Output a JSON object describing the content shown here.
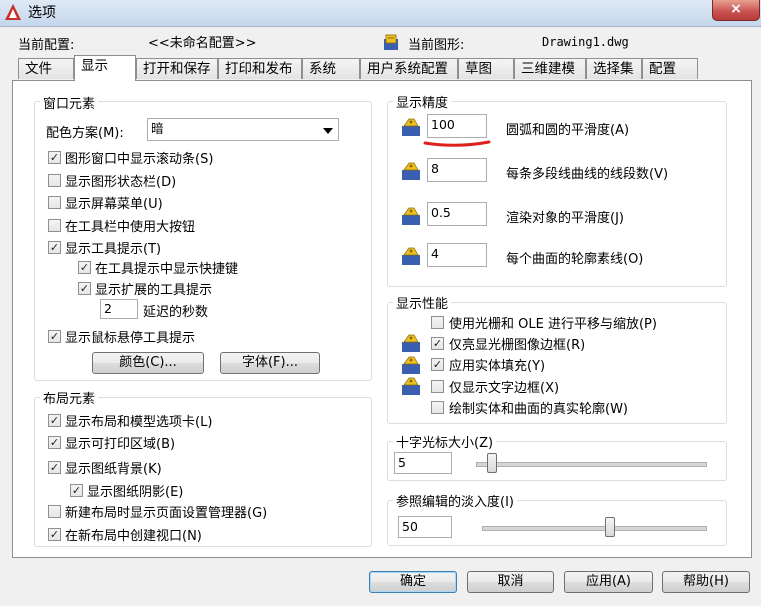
{
  "window": {
    "title": "选项",
    "close_label": "×"
  },
  "profile": {
    "current_profile_label": "当前配置:",
    "current_profile_value": "<<未命名配置>>",
    "current_drawing_label": "当前图形:",
    "current_drawing_value": "Drawing1.dwg"
  },
  "tabs": [
    "文件",
    "显示",
    "打开和保存",
    "打印和发布",
    "系统",
    "用户系统配置",
    "草图",
    "三维建模",
    "选择集",
    "配置"
  ],
  "window_elements": {
    "title": "窗口元素",
    "color_scheme_label": "配色方案(M):",
    "color_scheme_value": "暗",
    "checks": [
      {
        "label": "图形窗口中显示滚动条(S)",
        "checked": true
      },
      {
        "label": "显示图形状态栏(D)",
        "checked": false
      },
      {
        "label": "显示屏幕菜单(U)",
        "checked": false
      },
      {
        "label": "在工具栏中使用大按钮",
        "checked": false
      },
      {
        "label": "显示工具提示(T)",
        "checked": true
      },
      {
        "label": "在工具提示中显示快捷键",
        "checked": true
      },
      {
        "label": "显示扩展的工具提示",
        "checked": true
      },
      {
        "label": "显示鼠标悬停工具提示",
        "checked": true
      }
    ],
    "delay_value": "2",
    "delay_label": "延迟的秒数",
    "colors_button": "颜色(C)...",
    "fonts_button": "字体(F)..."
  },
  "layout_elements": {
    "title": "布局元素",
    "checks": [
      {
        "label": "显示布局和模型选项卡(L)",
        "checked": true
      },
      {
        "label": "显示可打印区域(B)",
        "checked": true
      },
      {
        "label": "显示图纸背景(K)",
        "checked": true
      },
      {
        "label": "显示图纸阴影(E)",
        "checked": true
      },
      {
        "label": "新建布局时显示页面设置管理器(G)",
        "checked": false
      },
      {
        "label": "在新布局中创建视口(N)",
        "checked": true
      }
    ]
  },
  "display_resolution": {
    "title": "显示精度",
    "rows": [
      {
        "value": "100",
        "label": "圆弧和圆的平滑度(A)"
      },
      {
        "value": "8",
        "label": "每条多段线曲线的线段数(V)"
      },
      {
        "value": "0.5",
        "label": "渲染对象的平滑度(J)"
      },
      {
        "value": "4",
        "label": "每个曲面的轮廓素线(O)"
      }
    ],
    "highlight_color": "#e0201a"
  },
  "display_performance": {
    "title": "显示性能",
    "checks": [
      {
        "label": "使用光栅和 OLE 进行平移与缩放(P)",
        "checked": false
      },
      {
        "label": "仅亮显光栅图像边框(R)",
        "checked": true
      },
      {
        "label": "应用实体填充(Y)",
        "checked": true
      },
      {
        "label": "仅显示文字边框(X)",
        "checked": false
      },
      {
        "label": "绘制实体和曲面的真实轮廓(W)",
        "checked": false
      }
    ]
  },
  "crosshair": {
    "title": "十字光标大小(Z)",
    "value": "5",
    "level_fraction": 0.05
  },
  "xref_fade": {
    "title": "参照编辑的淡入度(I)",
    "value": "50",
    "level_fraction": 0.55
  },
  "footer": {
    "ok": "确定",
    "cancel": "取消",
    "apply": "应用(A)",
    "help": "帮助(H)"
  },
  "colors": {
    "accent_check": "#222222",
    "icon_yellow": "#f0c020",
    "icon_blue": "#3a5fb0"
  }
}
